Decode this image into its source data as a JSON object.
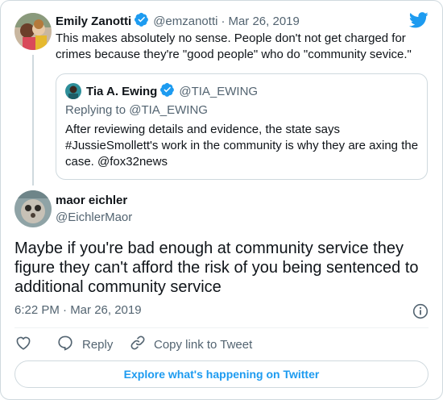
{
  "parent_tweet": {
    "author_name": "Emily Zanotti",
    "handle": "@emzanotti",
    "separator": "·",
    "date": "Mar 26, 2019",
    "text": "This makes absolutely no sense. People don't not get charged for crimes because they're \"good people\" who do \"community sevice.\""
  },
  "quoted_tweet": {
    "author_name": "Tia A. Ewing",
    "handle": "@TIA_EWING",
    "replying_to": "Replying to @TIA_EWING",
    "text": "After reviewing details and evidence, the state says #JussieSmollett's work in the community is why they are axing the case. @fox32news"
  },
  "main_tweet": {
    "author_name": "maor eichler",
    "handle": "@EichlerMaor",
    "text": "Maybe if you're bad enough at community service they figure they can't afford the risk of you being sentenced to additional community service",
    "timestamp": "6:22 PM · Mar 26, 2019"
  },
  "actions": {
    "reply_label": "Reply",
    "copy_link_label": "Copy link to Tweet"
  },
  "explore_label": "Explore what's happening on Twitter",
  "colors": {
    "brand": "#1d9bf0",
    "text": "#0f1419",
    "muted": "#536471",
    "border": "#cfd9de"
  }
}
